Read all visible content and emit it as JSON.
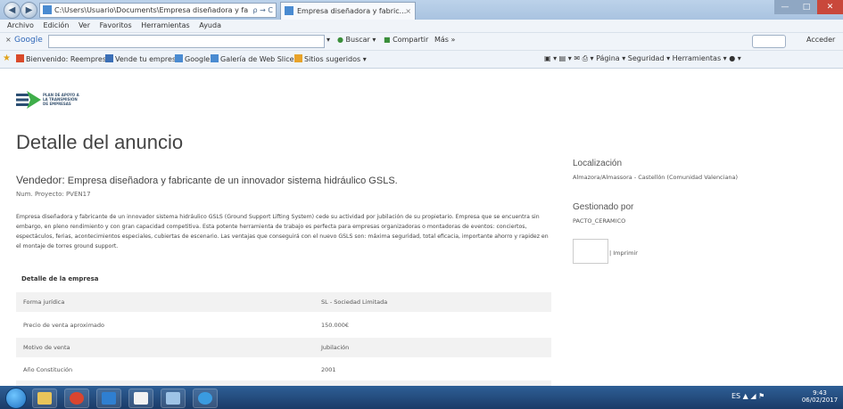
{
  "browser": {
    "address": "C:\\Users\\Usuario\\Documents\\Empresa diseñadora y fa",
    "address_controls": "ρ → C",
    "tab_title": "Empresa diseñadora y fabric...",
    "tab_close": "×",
    "back": "◀",
    "forward": "▶",
    "right_icons": "⌂ ☆ ⚙"
  },
  "menu": {
    "items": [
      "Archivo",
      "Edición",
      "Ver",
      "Favoritos",
      "Herramientas",
      "Ayuda"
    ]
  },
  "google_toolbar": {
    "close": "×",
    "logo": "Google",
    "buscar": "Buscar ▾",
    "compartir": "Compartir",
    "mas": "Más »",
    "acceder": "Acceder"
  },
  "favorites": {
    "items": [
      {
        "label": "Bienvenido: Reempresa",
        "color": "#d94a2a"
      },
      {
        "label": "Vende tu empresa",
        "color": "#3b6fb6"
      },
      {
        "label": "Google",
        "color": "#4a8bd1"
      },
      {
        "label": "Galería de Web Slice ▾",
        "color": "#4a8bd1"
      },
      {
        "label": "Sitios sugeridos ▾",
        "color": "#e8a32a"
      }
    ],
    "command_bar": "▣ ▾  ▤ ▾  ✉  ⎙ ▾  Página ▾  Seguridad ▾  Herramientas ▾  ● ▾"
  },
  "page": {
    "logo_text": "PLAN DE APOYO A LA TRANSMISIÓN DE EMPRESAS",
    "title": "Detalle del anuncio",
    "vendor_label": "Vendedor:",
    "vendor_name": "Empresa diseñadora y fabricante de un innovador sistema hidráulico GSLS.",
    "project_number": "Num. Proyecto: PVEN17",
    "description": "Empresa diseñadora y fabricante de un innovador sistema hidráulico GSLS (Ground Support Lifting System) cede su actividad por jubilación de su propietario. Empresa que se encuentra sin embargo, en pleno rendimiento y con gran capacidad competitiva. Esta potente herramienta de trabajo es perfecta para empresas organizadoras o montadoras de eventos: conciertos, espectáculos, ferias, acontecimientos especiales, cubiertas de escenario. Las ventajas que conseguirá con el nuevo GSLS son: máxima seguridad, total eficacia, importante ahorro y rapidez en el montaje de torres ground support.",
    "details_title": "Detalle de la empresa",
    "details": [
      {
        "key": "Forma jurídica",
        "value": "SL - Sociedad Limitada"
      },
      {
        "key": "Precio de venta aproximado",
        "value": "150.000€"
      },
      {
        "key": "Motivo de venta",
        "value": "Jubilación"
      },
      {
        "key": "Año Constitución",
        "value": "2001"
      }
    ]
  },
  "sidebar": {
    "location_label": "Localización",
    "location_value": "Almazora/Almassora - Castellón (Comunidad Valenciana)",
    "managed_label": "Gestionado por",
    "managed_value": "PACTO_CERAMICO",
    "print_label": "| Imprimir"
  },
  "taskbar": {
    "tray": "ES  ▲  ◢  ⚑",
    "time": "9:43",
    "date": "06/02/2017",
    "icons": [
      {
        "name": "file-explorer-icon",
        "color": "#e8c45a"
      },
      {
        "name": "chrome-icon",
        "color": "#d9452f"
      },
      {
        "name": "outlook-icon",
        "color": "#2f7fd1"
      },
      {
        "name": "word-icon",
        "color": "#f2f2f2"
      },
      {
        "name": "control-panel-icon",
        "color": "#9ec3e6"
      },
      {
        "name": "internet-explorer-icon",
        "color": "#3a9be0"
      }
    ]
  },
  "colors": {
    "taskbar": "#1f4373",
    "accent": "#2d66b8"
  }
}
